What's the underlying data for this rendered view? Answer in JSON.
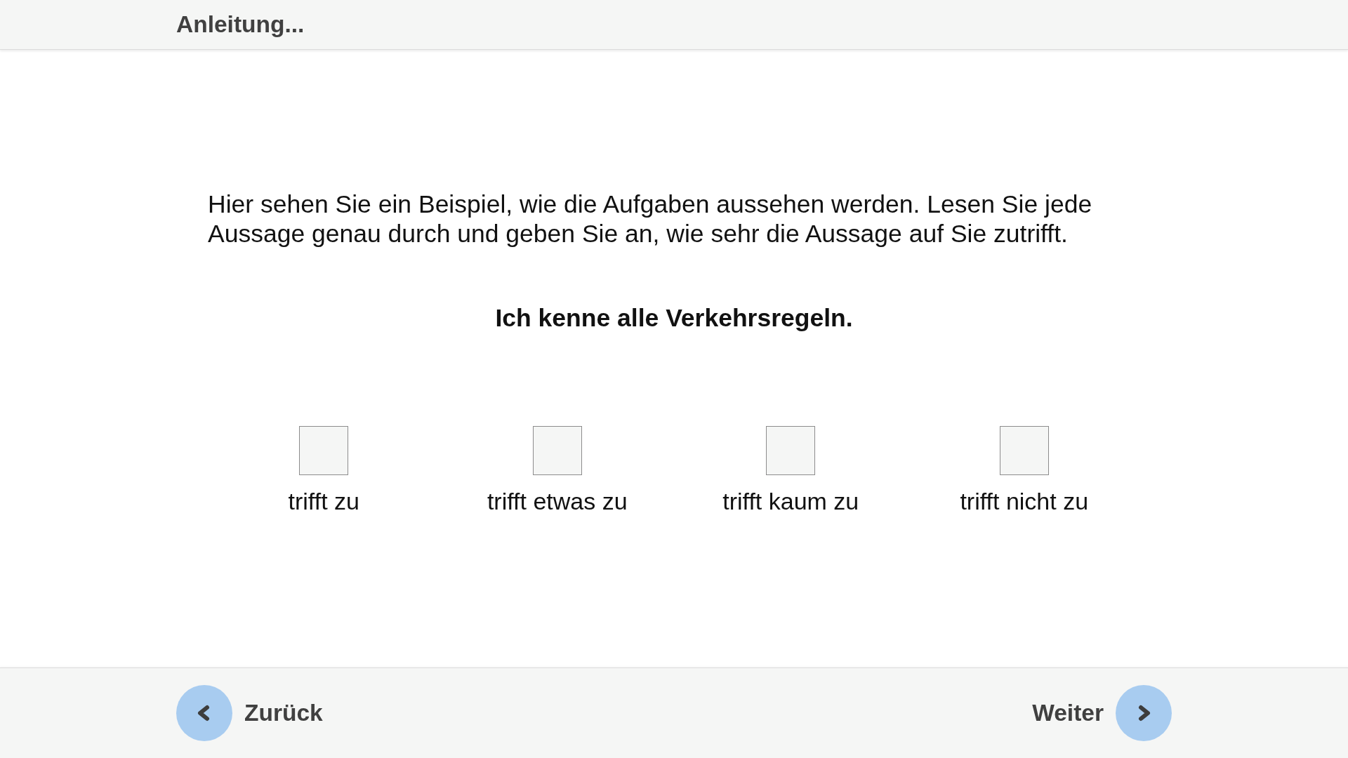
{
  "header": {
    "title": "Anleitung..."
  },
  "instruction": "Hier sehen Sie ein Beispiel, wie die Aufgaben aussehen werden. Lesen Sie jede Aussage genau durch und geben Sie an, wie sehr die Aussage auf Sie zutrifft.",
  "statement": "Ich kenne alle Verkehrsregeln.",
  "options": [
    {
      "label": "trifft zu",
      "checked": false
    },
    {
      "label": "trifft etwas zu",
      "checked": false
    },
    {
      "label": "trifft kaum zu",
      "checked": false
    },
    {
      "label": "trifft nicht zu",
      "checked": false
    }
  ],
  "footer": {
    "back": {
      "label": "Zurück"
    },
    "next": {
      "label": "Weiter"
    }
  }
}
